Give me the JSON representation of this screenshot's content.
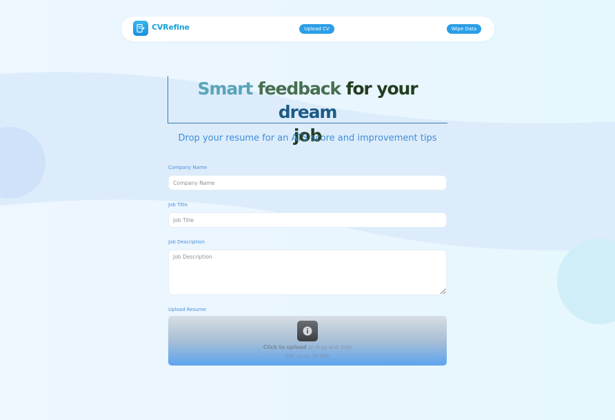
{
  "navbar": {
    "brand": "CVRefine",
    "logo_icon": "document-icon",
    "upload_label": "Upload CV",
    "wipe_label": "Wipe Data"
  },
  "hero": {
    "title_part1": "Smart",
    "title_part2": "feedback",
    "title_part3": "for your",
    "title_part4": "dream",
    "title_part5": "job",
    "subtitle": "Drop your resume for an ATS score and improvement tips"
  },
  "form": {
    "company_label": "Company Name",
    "company_placeholder": "Company Name",
    "job_title_label": "Job Title",
    "job_title_placeholder": "Job Title",
    "job_desc_label": "Job Description",
    "job_desc_placeholder": "Job Description",
    "resume_label": "Upload Resume",
    "upload_icon": "info-icon",
    "click_to_upload": "Click to upload",
    "drag_text": " or drag and drop",
    "file_hint": "PDF (max 20 MB)"
  },
  "colors": {
    "accent": "#2a9ee6",
    "brand": "#17a2d8",
    "label": "#4a8ed8"
  }
}
